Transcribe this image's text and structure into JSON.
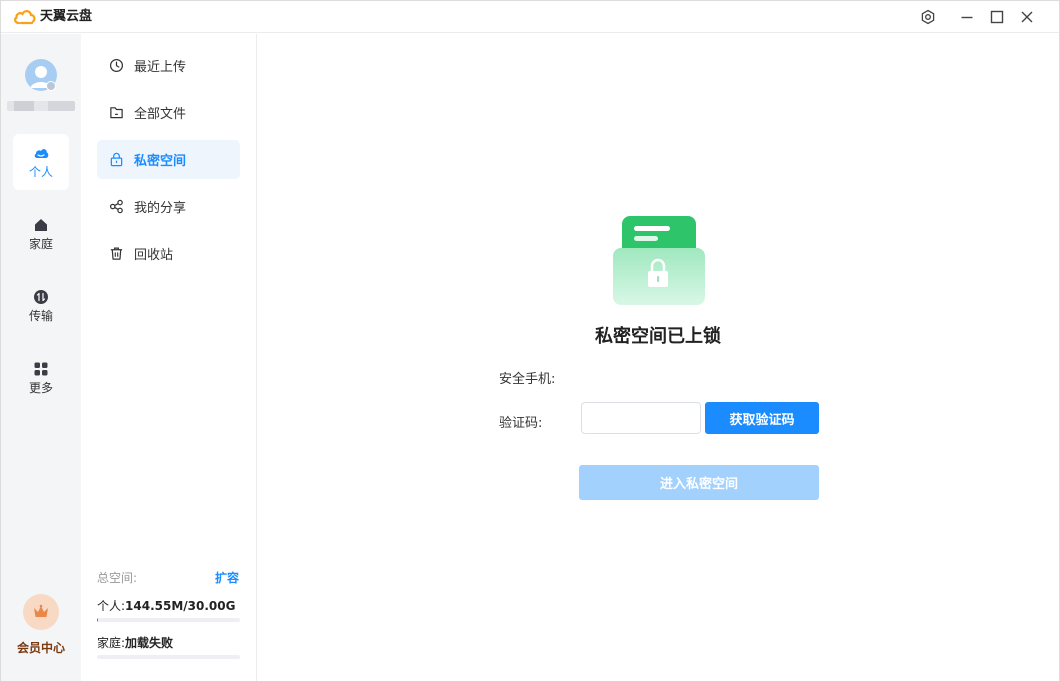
{
  "app": {
    "title": "天翼云盘"
  },
  "rail": {
    "items": [
      {
        "label": "个人",
        "icon": "cloud-icon",
        "active": true
      },
      {
        "label": "家庭",
        "icon": "home-icon",
        "active": false
      },
      {
        "label": "传输",
        "icon": "transfer-icon",
        "active": false
      },
      {
        "label": "更多",
        "icon": "grid-icon",
        "active": false
      }
    ],
    "vip_label": "会员中心"
  },
  "sidebar": {
    "items": [
      {
        "label": "最近上传",
        "icon": "clock-icon",
        "active": false
      },
      {
        "label": "全部文件",
        "icon": "folder-icon",
        "active": false
      },
      {
        "label": "私密空间",
        "icon": "lock-icon",
        "active": true
      },
      {
        "label": "我的分享",
        "icon": "share-icon",
        "active": false
      },
      {
        "label": "回收站",
        "icon": "trash-icon",
        "active": false
      }
    ],
    "storage": {
      "title": "总空间:",
      "expand": "扩容",
      "personal_key": "个人:",
      "personal_value": "144.55M/30.00G",
      "personal_fraction": 0.005,
      "family_key": "家庭:",
      "family_value": "加载失败",
      "family_fraction": 0
    }
  },
  "main": {
    "headline": "私密空间已上锁",
    "phone_label": "安全手机:",
    "phone_value": "",
    "code_label": "验证码:",
    "code_value": "",
    "get_code_label": "获取验证码",
    "enter_label": "进入私密空间"
  },
  "colors": {
    "accent": "#1a8cff",
    "accent_disabled": "#a3d1fe",
    "green": "#2ec46a"
  }
}
